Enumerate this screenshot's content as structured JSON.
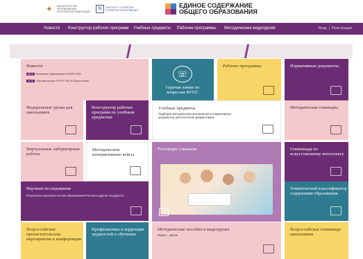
{
  "header": {
    "ministry_text": "МИНИСТЕРСТВО ПРОСВЕЩЕНИЯ РОССИЙСКОЙ ФЕДЕРАЦИИ",
    "institute_text": "ИНСТИТУТ СТРАТЕГИИ РАЗВИТИЯ ОБРАЗОВАНИЯ",
    "brand_line1": "ЕДИНОЕ СОДЕРЖАНИЕ",
    "brand_line2": "ОБЩЕГО ОБРАЗОВАНИЯ",
    "brand_colors": [
      "#f2a33a",
      "#3b7ec7",
      "#d64b7a",
      "#6b2c73"
    ]
  },
  "nav": {
    "items": [
      "Новости",
      "Конструктор рабочих программ",
      "Учебные предметы",
      "Рабочие программы",
      "Методические видеоуроки"
    ],
    "login": "Вход",
    "register": "Регистрация"
  },
  "tiles": {
    "news": {
      "title": "Новости",
      "items": [
        {
          "date": "28.10",
          "text": "Флагманы образования в ИСРО РАО"
        },
        {
          "date": "27.10",
          "text": "«Летняя школа» ИСРО РАО в Кыргызстане"
        }
      ]
    },
    "hotline": {
      "title": "Горячая линия по вопросам ФГОС"
    },
    "work_programs": {
      "title": "Рабочие программы"
    },
    "normative_docs": {
      "title": "Нормативные документы"
    },
    "federal_lessons": {
      "title": "Федеральные уроки для школьников"
    },
    "constructor": {
      "title": "Конструктор рабочих программ по учебным предметам"
    },
    "subjects": {
      "title": "Учебные предметы",
      "subtitle": "Подборка методических материалов и нормативных документов для учителей-предметников"
    },
    "seminars": {
      "title": "Методические семинары"
    },
    "virtual_labs": {
      "title": "Виртуальные лабораторные работы"
    },
    "interactive_cases": {
      "title": "Методические интерактивные кейсы"
    },
    "conversations": {
      "title": "Разговоры о важном"
    },
    "ai_olympiad": {
      "title": "Олимпиада по искусственному интеллекту"
    },
    "research": {
      "title": "Научные исследования",
      "subtitle": "Результаты изучения систем образования России и других государств"
    },
    "classifier": {
      "title": "Тематический классификатор содержания образования"
    },
    "events": {
      "title": "Всероссийские просветительские мероприятия и конференции"
    },
    "prevention": {
      "title": "Профилактика и коррекция трудностей в обучении"
    },
    "manuals": {
      "title": "Методические пособия и видеоуроки",
      "subtitle": "Наука – школе"
    },
    "school_olympiad": {
      "title": "Всероссийская олимпиада школьников"
    }
  }
}
